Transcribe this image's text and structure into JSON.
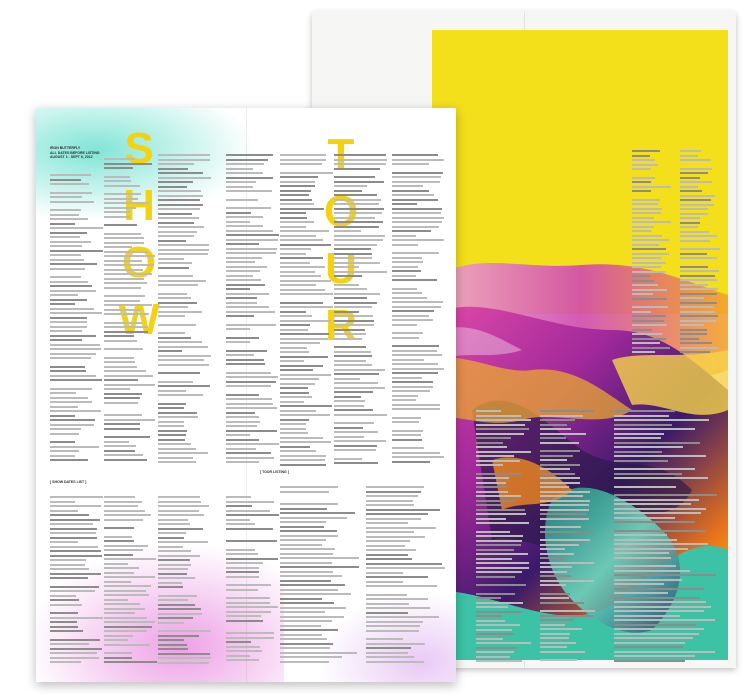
{
  "scene": {
    "description_items": [
      "front-sheet",
      "back-spread"
    ]
  },
  "front_sheet": {
    "big_letters_left": [
      "S",
      "H",
      "O",
      "W"
    ],
    "big_letters_right": [
      "T",
      "O",
      "U",
      "R"
    ],
    "header": "IRON BUTTERFLY",
    "subheader": "ALL DATES BEFORE LISTING",
    "dates_line": "AUGUST 1 - SEPT 6, 2012",
    "banner_left": "[ SHOW DATES LIST ]",
    "banner_right": "[ TOUR LISTING ]"
  },
  "back_spread": {
    "colors": {
      "yellow": "#f3df1a",
      "teal": "#3cc3a5",
      "magenta": "#c03aa8",
      "orange": "#f08a1c"
    }
  }
}
